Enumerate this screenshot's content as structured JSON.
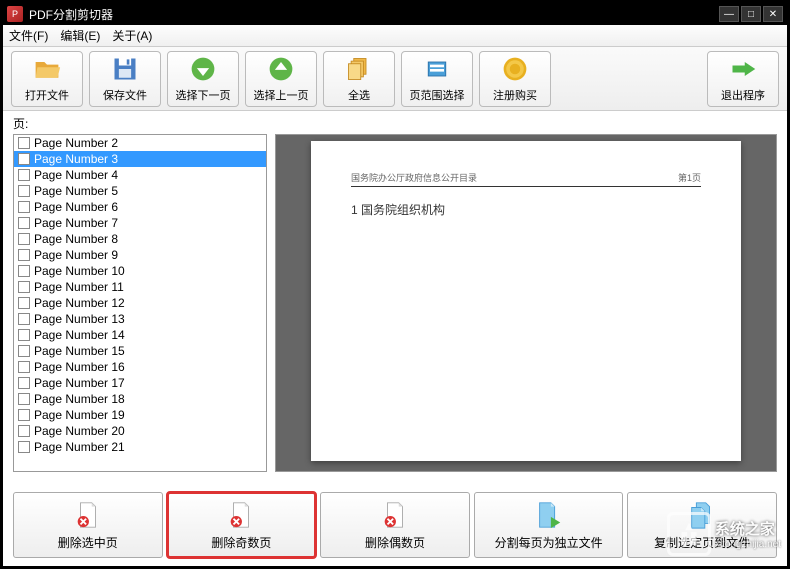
{
  "titlebar": {
    "title": "PDF分割剪切器"
  },
  "menubar": {
    "file": "文件(F)",
    "edit": "编辑(E)",
    "about": "关于(A)"
  },
  "toolbar": {
    "open": "打开文件",
    "save": "保存文件",
    "select_next": "选择下一页",
    "select_prev": "选择上一页",
    "select_all": "全选",
    "select_range": "页范围选择",
    "register": "注册购买",
    "exit": "退出程序"
  },
  "content": {
    "pages_label": "页:"
  },
  "page_list": {
    "items": [
      {
        "label": "Page Number 2",
        "selected": false
      },
      {
        "label": "Page Number 3",
        "selected": true
      },
      {
        "label": "Page Number 4",
        "selected": false
      },
      {
        "label": "Page Number 5",
        "selected": false
      },
      {
        "label": "Page Number 6",
        "selected": false
      },
      {
        "label": "Page Number 7",
        "selected": false
      },
      {
        "label": "Page Number 8",
        "selected": false
      },
      {
        "label": "Page Number 9",
        "selected": false
      },
      {
        "label": "Page Number 10",
        "selected": false
      },
      {
        "label": "Page Number 11",
        "selected": false
      },
      {
        "label": "Page Number 12",
        "selected": false
      },
      {
        "label": "Page Number 13",
        "selected": false
      },
      {
        "label": "Page Number 14",
        "selected": false
      },
      {
        "label": "Page Number 15",
        "selected": false
      },
      {
        "label": "Page Number 16",
        "selected": false
      },
      {
        "label": "Page Number 17",
        "selected": false
      },
      {
        "label": "Page Number 18",
        "selected": false
      },
      {
        "label": "Page Number 19",
        "selected": false
      },
      {
        "label": "Page Number 20",
        "selected": false
      },
      {
        "label": "Page Number 21",
        "selected": false
      }
    ]
  },
  "preview": {
    "header_left": "国务院办公厅政府信息公开目录",
    "header_right": "第1页",
    "body": "1  国务院组织机构"
  },
  "bottom_toolbar": {
    "delete_selected": "删除选中页",
    "delete_odd": "删除奇数页",
    "delete_even": "删除偶数页",
    "split_pages": "分割每页为独立文件",
    "copy_pages": "复制选定页到文件"
  },
  "watermark": {
    "text": "系统之家",
    "url": "xitongzhijia.net"
  }
}
